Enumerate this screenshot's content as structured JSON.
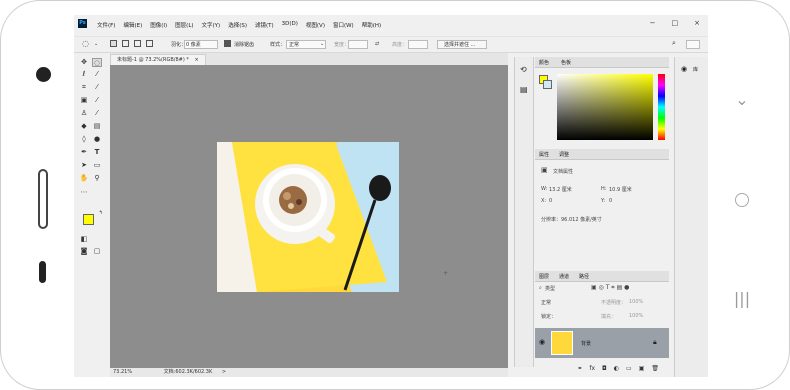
{
  "app": {
    "logo": "Ps",
    "menu": [
      "文件(F)",
      "编辑(E)",
      "图像(I)",
      "图层(L)",
      "文字(Y)",
      "选择(S)",
      "滤镜(T)",
      "3D(D)",
      "视图(V)",
      "窗口(W)",
      "帮助(H)"
    ],
    "window_buttons": [
      "−",
      "□",
      "×"
    ]
  },
  "options": {
    "feather_label": "羽化：",
    "feather_value": "0 像素",
    "antialias_label": "消除锯齿",
    "style_label": "样式：",
    "style_value": "正常",
    "width_label": "宽度：",
    "height_label": "高度：",
    "select_mask_button": "选择并遮住 ..."
  },
  "document": {
    "tab_title": "未标题-1 @ 73.2%(RGB/8#) *",
    "tab_close": "×",
    "zoom": "73.21%",
    "doc_info": "文档:602.3K/602.3K",
    "arrow": ">"
  },
  "panels": {
    "color_tabs": [
      "颜色",
      "色板"
    ],
    "properties_tabs": [
      "属性",
      "调整"
    ],
    "properties_title": "文档属性",
    "w_label": "W:",
    "w_value": "13.2 厘米",
    "h_label": "H:",
    "h_value": "10.9 厘米",
    "x_label": "X:",
    "x_value": "0",
    "y_label": "Y:",
    "y_value": "0",
    "resolution": "分辨率：96.012 像素/英寸",
    "layers_tabs": [
      "图层",
      "通道",
      "路径"
    ],
    "kind_label": "类型",
    "blend_mode": "正常",
    "opacity_label": "不透明度：",
    "opacity_value": "100%",
    "lock_label": "锁定：",
    "fill_label": "填充：",
    "fill_value": "100%",
    "layer_name": "背景"
  },
  "colors": {
    "foreground": "#ffff00",
    "background": "#cfe9f7",
    "accent": "#31a8ff"
  }
}
